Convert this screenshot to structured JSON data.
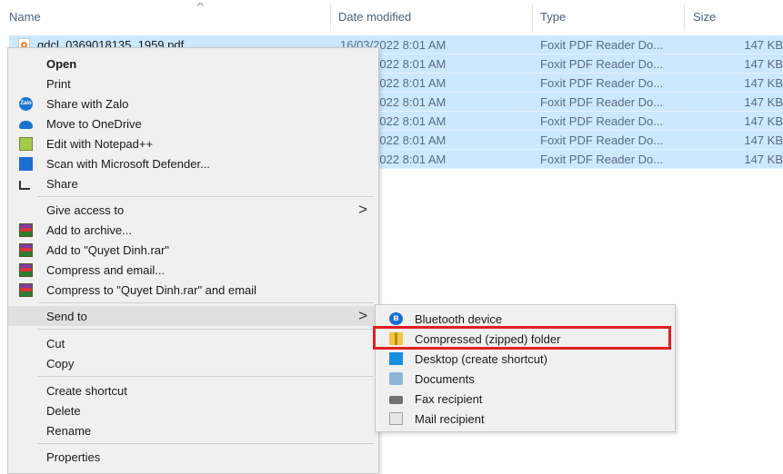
{
  "columns": {
    "name": "Name",
    "date": "Date modified",
    "type": "Type",
    "size": "Size"
  },
  "files": [
    {
      "name": "gdcl_0369018135_1959.pdf",
      "date": "16/03/2022 8:01 AM",
      "type": "Foxit PDF Reader Do...",
      "size": "147 KB"
    },
    {
      "name": "",
      "date": "16/03/2022 8:01 AM",
      "type": "Foxit PDF Reader Do...",
      "size": "147 KB"
    },
    {
      "name": "",
      "date": "16/03/2022 8:01 AM",
      "type": "Foxit PDF Reader Do...",
      "size": "147 KB"
    },
    {
      "name": "",
      "date": "16/03/2022 8:01 AM",
      "type": "Foxit PDF Reader Do...",
      "size": "147 KB"
    },
    {
      "name": "",
      "date": "16/03/2022 8:01 AM",
      "type": "Foxit PDF Reader Do...",
      "size": "147 KB"
    },
    {
      "name": "",
      "date": "16/03/2022 8:01 AM",
      "type": "Foxit PDF Reader Do...",
      "size": "147 KB"
    },
    {
      "name": "",
      "date": "16/03/2022 8:01 AM",
      "type": "Foxit PDF Reader Do...",
      "size": "147 KB"
    }
  ],
  "context_menu": {
    "open": "Open",
    "print": "Print",
    "share_zalo": "Share with Zalo",
    "zalo_icon_text": "Zalo",
    "move_onedrive": "Move to OneDrive",
    "edit_notepad": "Edit with Notepad++",
    "scan_defender": "Scan with Microsoft Defender...",
    "share": "Share",
    "give_access": "Give access to",
    "add_archive": "Add to archive...",
    "add_rar": "Add to \"Quyet Dinh.rar\"",
    "compress_email": "Compress and email...",
    "compress_rar_email": "Compress to \"Quyet Dinh.rar\" and email",
    "send_to": "Send to",
    "cut": "Cut",
    "copy": "Copy",
    "create_shortcut": "Create shortcut",
    "delete": "Delete",
    "rename": "Rename",
    "properties": "Properties",
    "submenu_arrow": ">"
  },
  "send_to_menu": {
    "bluetooth": "Bluetooth device",
    "bluetooth_glyph": "ʙ",
    "zipped": "Compressed (zipped) folder",
    "desktop": "Desktop (create shortcut)",
    "documents": "Documents",
    "fax": "Fax recipient",
    "mail": "Mail recipient"
  },
  "colors": {
    "selection": "#cce8ff",
    "menu_bg": "#f0f0f0",
    "highlight_border": "#e02020"
  }
}
